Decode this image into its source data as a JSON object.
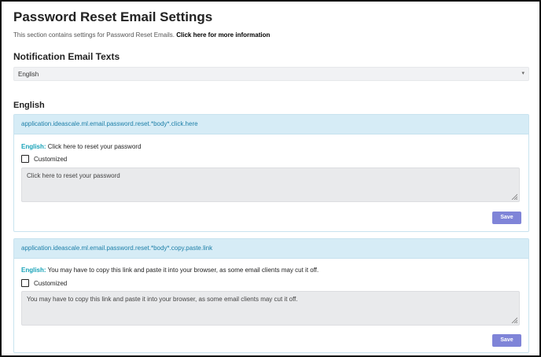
{
  "page": {
    "title": "Password Reset Email Settings",
    "intro_text": "This section contains settings for Password Reset Emails.",
    "intro_link": "Click here for more information"
  },
  "notification_texts": {
    "heading": "Notification Email Texts",
    "language_select": {
      "selected": "English",
      "caret": "▾"
    }
  },
  "language_section": {
    "heading": "English"
  },
  "cards": [
    {
      "key": "application.ideascale.ml.email.password.reset.*body*.click.here",
      "lang_label": "English:",
      "lang_text": "Click here to reset your password",
      "customized_label": "Customized",
      "customized": false,
      "textarea_value": "Click here to reset your password",
      "save_label": "Save"
    },
    {
      "key": "application.ideascale.ml.email.password.reset.*body*.copy.paste.link",
      "lang_label": "English:",
      "lang_text": "You may have to copy this link and paste it into your browser, as some email clients may cut it off.",
      "customized_label": "Customized",
      "customized": false,
      "textarea_value": "You may have to copy this link and paste it into your browser, as some email clients may cut it off.",
      "save_label": "Save"
    }
  ],
  "colors": {
    "card_header_bg": "#d6ecf6",
    "card_header_text": "#1c7fa8",
    "lang_tag": "#17a2b8",
    "save_button": "#7f84d8",
    "textarea_bg": "#e9eaec"
  },
  "icons": {
    "select_caret": "chevron-down-icon",
    "textarea_resize": "resize-handle-icon"
  }
}
